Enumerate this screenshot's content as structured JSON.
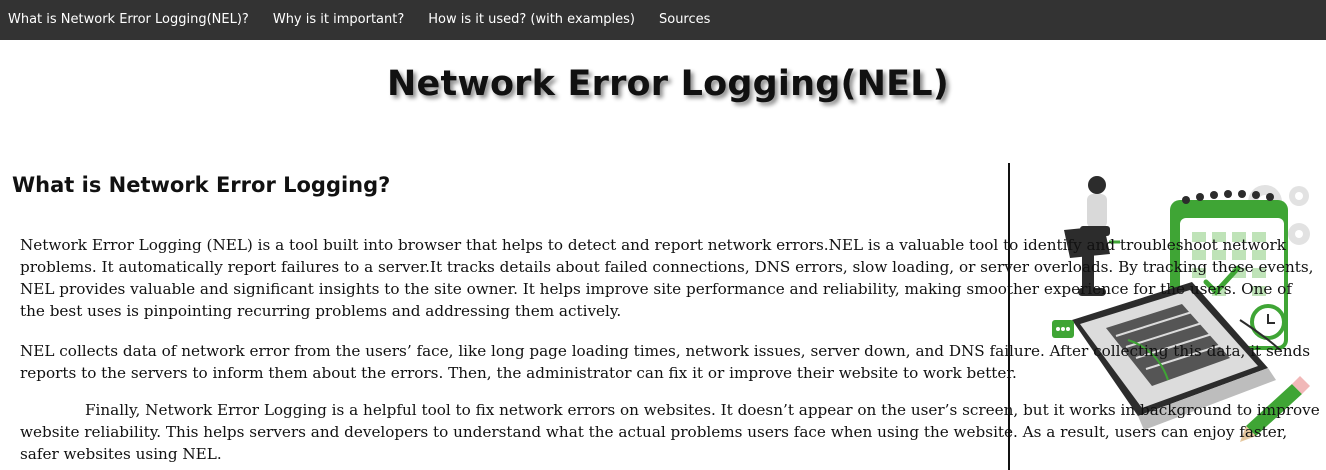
{
  "nav": {
    "items": [
      {
        "label": "What is Network Error Logging(NEL)?"
      },
      {
        "label": "Why is it important?"
      },
      {
        "label": "How is it used? (with examples)"
      },
      {
        "label": "Sources"
      }
    ]
  },
  "page_title": "Network Error Logging(NEL)",
  "section": {
    "heading": "What is Network Error Logging?",
    "paragraphs": [
      "Network Error Logging (NEL) is a tool built into browser that helps to detect and report network errors.NEL is a valuable tool to identify and troubleshoot network problems. It automatically report failures to a server.It tracks details about failed connections, DNS errors, slow loading, or server overloads. By tracking these events, NEL provides valuable and significant insights to the site owner. It helps improve site performance and reliability, making smoother experience for the users. One of the best uses is pinpointing recurring problems and addressing them actively.",
      "NEL collects data of network error from the users’ face, like long page loading times, network issues, server down, and DNS failure. After collecting this data, it sends reports to the servers to inform them about the errors. Then, the administrator can fix it or improve their website to work better.",
      "Finally, Network Error Logging is a helpful tool to fix network errors on websites. It doesn’t appear on the user’s screen, but it works in background to improve website reliability. This helps servers and developers to understand what the actual problems users face when using the website. As a result, users can enjoy faster, safer websites using NEL."
    ]
  },
  "illustration": {
    "icon": "laptop-calendar-person-illustration",
    "accent_color": "#3fa535"
  }
}
